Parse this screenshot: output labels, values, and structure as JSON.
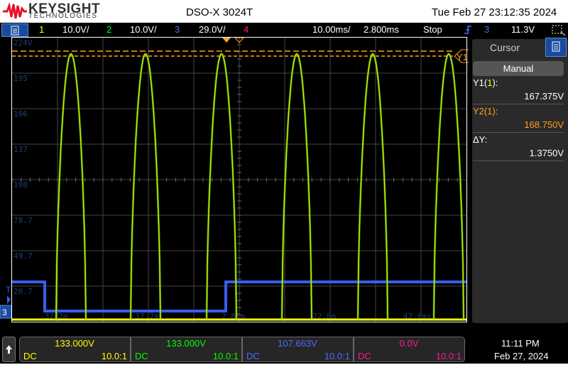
{
  "header": {
    "brand": "KEYSIGHT",
    "brand_sub": "TECHNOLOGIES",
    "model": "DSO-X  3024T",
    "datetime": "Tue Feb 27 23:12:35 2024"
  },
  "toolbar": {
    "ch1": "1",
    "ch1_scale": "10.0V/",
    "ch2": "2",
    "ch2_scale": "10.0V/",
    "ch3": "3",
    "ch3_scale": "29.0V/",
    "ch4": "4",
    "timebase": "10.00ms/",
    "delay": "2.800ms",
    "run_state": "Stop",
    "trig_source": "3",
    "trig_level": "11.3V"
  },
  "plot": {
    "y_labels": [
      "224V",
      "195",
      "166",
      "137",
      "108",
      "78.7",
      "49.7",
      "20.7"
    ],
    "x_labels": [
      "-37.2m",
      "-17.2m",
      "2.80m",
      "22.8m",
      "42.8ms"
    ],
    "cursor_label": "Y1",
    "trigger_marker": "T",
    "ch3_marker": "3"
  },
  "cursor_panel": {
    "title": "Cursor",
    "mode": "Manual",
    "y1_label": "Y1(",
    "y1_ch": "1",
    "y1_end": "):",
    "y1_value": "167.375V",
    "y2_label": "Y2(1):",
    "y2_value": "168.750V",
    "dy_label": "ΔY:",
    "dy_value": "1.3750V"
  },
  "channels": [
    {
      "offset": "133.000V",
      "coupling": "DC",
      "probe": "10.0:1",
      "color": "#ffff00"
    },
    {
      "offset": "133.000V",
      "coupling": "DC",
      "probe": "10.0:1",
      "color": "#00ff00"
    },
    {
      "offset": "107.663V",
      "coupling": "DC",
      "probe": "10.0:1",
      "color": "#4a6cff"
    },
    {
      "offset": "0.0V",
      "coupling": "DC",
      "probe": "10.0:1",
      "color": "#ff1a8c"
    }
  ],
  "clock": {
    "time": "11:11 PM",
    "date": "Feb 27, 2024"
  },
  "colors": {
    "ch1": "#ffff00",
    "ch2": "#00ff00",
    "ch3": "#3a5cf0",
    "cursor": "#ffa020",
    "grid_label": "#1c3c7a"
  }
}
